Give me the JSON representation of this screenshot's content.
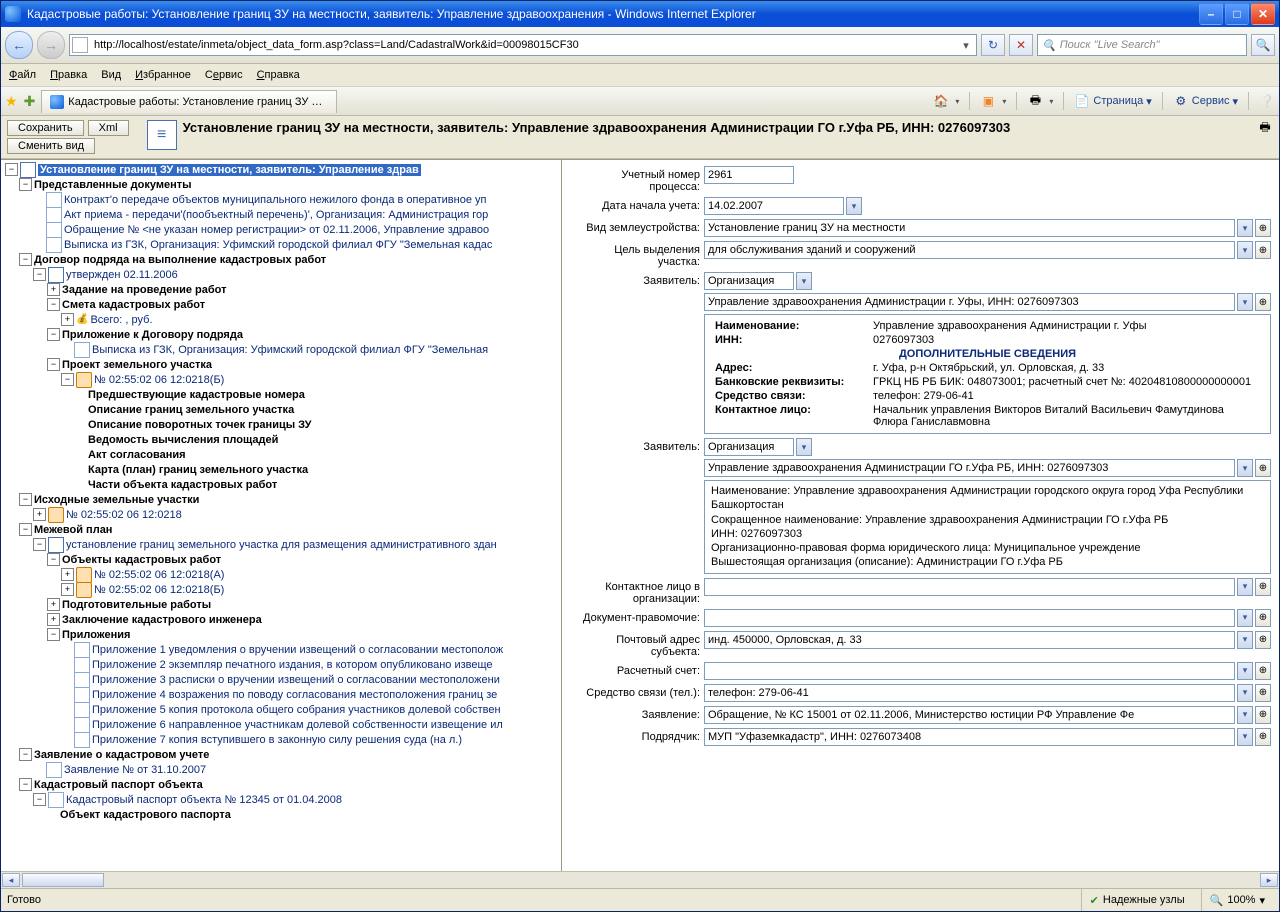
{
  "window": {
    "title": "Кадастровые работы: Установление границ ЗУ на местности, заявитель: Управление здравоохранения  - Windows Internet Explorer",
    "url": "http://localhost/estate/inmeta/object_data_form.asp?class=Land/CadastralWork&id=00098015CF30",
    "search_placeholder": "Поиск \"Live Search\""
  },
  "menu": {
    "file": "Файл",
    "edit": "Правка",
    "view": "Вид",
    "favorites": "Избранное",
    "service": "Сервис",
    "help": "Справка"
  },
  "tab": {
    "label": "Кадастровые работы: Установление границ ЗУ на..."
  },
  "ie_tools": {
    "page": "Страница",
    "service": "Сервис"
  },
  "app": {
    "save": "Сохранить",
    "xml": "Xml",
    "switch_view": "Сменить вид",
    "title": "Установление границ ЗУ на местности, заявитель: Управление здравоохранения Администрации ГО г.Уфа РБ, ИНН: 0276097303"
  },
  "tree": {
    "root": "Установление границ ЗУ на местности, заявитель: Управление здрав",
    "docs_presented": "Представленные документы",
    "d1": "Контракт'о передаче объектов муниципального нежилого фонда в оперативное уп",
    "d2": "Акт приема - передачи'(пообъектный перечень)', Организация: Администрация гор",
    "d3": "Обращение № <не указан номер регистрации> от 02.11.2006, Управление здравоо",
    "d4": "Выписка из ГЗК, Организация: Уфимский городской филиал ФГУ \"Земельная кадас",
    "contract": "Договор подряда на выполнение кадастровых работ",
    "approved": "утвержден 02.11.2006",
    "task": "Задание на проведение работ",
    "estimate": "Смета кадастровых работ",
    "estimate_total": "Всего: , руб.",
    "appendix": "Приложение к Договору подряда",
    "appendix1": "Выписка из ГЗК, Организация: Уфимский городской филиал ФГУ \"Земельная",
    "project": "Проект земельного участка",
    "proj_num": "№ 02:55:02 06 12:0218(Б)",
    "prev_nums": "Предшествующие кадастровые номера",
    "bounds_desc": "Описание границ земельного участка",
    "points_desc": "Описание поворотных точек границы ЗУ",
    "area_calc": "Ведомость вычисления площадей",
    "act_agree": "Акт согласования",
    "map_plan": "Карта (план) границ земельного участка",
    "parts": "Части объекта кадастровых работ",
    "source_parcels": "Исходные земельные участки",
    "src1": "№ 02:55:02 06 12:0218",
    "survey_plan": "Межевой план",
    "survey_desc": "установление границ земельного участка для размещения административного здан",
    "objects": "Объекты кадастровых работ",
    "obj_a": "№ 02:55:02 06 12:0218(А)",
    "obj_b": "№ 02:55:02 06 12:0218(Б)",
    "prep": "Подготовительные работы",
    "concl": "Заключение кадастрового инженера",
    "attachments": "Приложения",
    "att1": "Приложение 1 уведомления о вручении извещений о согласовании местополож",
    "att2": "Приложение 2 экземпляр печатного издания, в котором опубликовано извеще",
    "att3": "Приложение 3 расписки о вручении извещений о согласовании местоположени",
    "att4": "Приложение 4 возражения по поводу согласования местоположения границ зе",
    "att5": "Приложение 5 копия протокола общего собрания участников долевой собствен",
    "att6": "Приложение 6 направленное участникам долевой собственности извещение ил",
    "att7": "Приложение 7 копия вступившего в законную силу решения суда (на л.)",
    "reg_app": "Заявление о кадастровом учете",
    "reg_app1": "Заявление № от 31.10.2007",
    "passport": "Кадастровый паспорт объекта",
    "passport1": "Кадастровый паспорт объекта № 12345 от 01.04.2008",
    "passport_obj": "Объект кадастрового паспорта"
  },
  "form": {
    "acct_label": "Учетный номер процесса:",
    "acct": "2961",
    "startdate_label": "Дата начала учета:",
    "startdate": "14.02.2007",
    "type_label": "Вид землеустройства:",
    "type": "Установление границ ЗУ на местности",
    "purpose_label": "Цель выделения участка:",
    "purpose": "для обслуживания зданий и сооружений",
    "applicant_label": "Заявитель:",
    "org_option": "Организация",
    "applicant1": "Управление здравоохранения Администрации г. Уфы, ИНН: 0276097303",
    "det1": {
      "name_k": "Наименование:",
      "name_v": "Управление здравоохранения Администрации г. Уфы",
      "inn_k": "ИНН:",
      "inn_v": "0276097303",
      "extra": "ДОПОЛНИТЕЛЬНЫЕ СВЕДЕНИЯ",
      "addr_k": "Адрес:",
      "addr_v": "г. Уфа, р-н Октябрьский, ул. Орловская, д. 33",
      "bank_k": "Банковские реквизиты:",
      "bank_v": "ГРКЦ НБ РБ БИК: 048073001; расчетный счет №: 40204810800000000001",
      "comm_k": "Средство связи:",
      "comm_v": "телефон: 279-06-41",
      "contact_k": "Контактное лицо:",
      "contact_v": "Начальник управления Викторов Виталий Васильевич Фамутдинова Флюра Ганиславмовна"
    },
    "applicant2": "Управление здравоохранения Администрации ГО г.Уфа РБ, ИНН: 0276097303",
    "det2": "Наименование: Управление здравоохранения Администрации городского округа город Уфа Республики Башкортостан\nСокращенное наименование: Управление здравоохранения Администрации ГО г.Уфа РБ\nИНН: 0276097303\nОрганизационно-правовая форма юридического лица: Муниципальное учреждение\nВышестоящая организация (описание): Администрации ГО г.Уфа РБ",
    "contact_org_label": "Контактное лицо в организации:",
    "doc_auth_label": "Документ-правомочие:",
    "postal_label": "Почтовый адрес субъекта:",
    "postal": "инд. 450000, Орловская, д. 33",
    "settle_label": "Расчетный счет:",
    "comm_label": "Средство связи (тел.):",
    "comm": "телефон: 279-06-41",
    "statement_label": "Заявление:",
    "statement": "Обращение, № КС 15001 от 02.11.2006, Министерство юстиции РФ Управление Фе",
    "contractor_label": "Подрядчик:",
    "contractor": "МУП \"Уфаземкадастр\", ИНН: 0276073408"
  },
  "status": {
    "ready": "Готово",
    "nodes": "Надежные узлы",
    "zoom": "100%"
  }
}
